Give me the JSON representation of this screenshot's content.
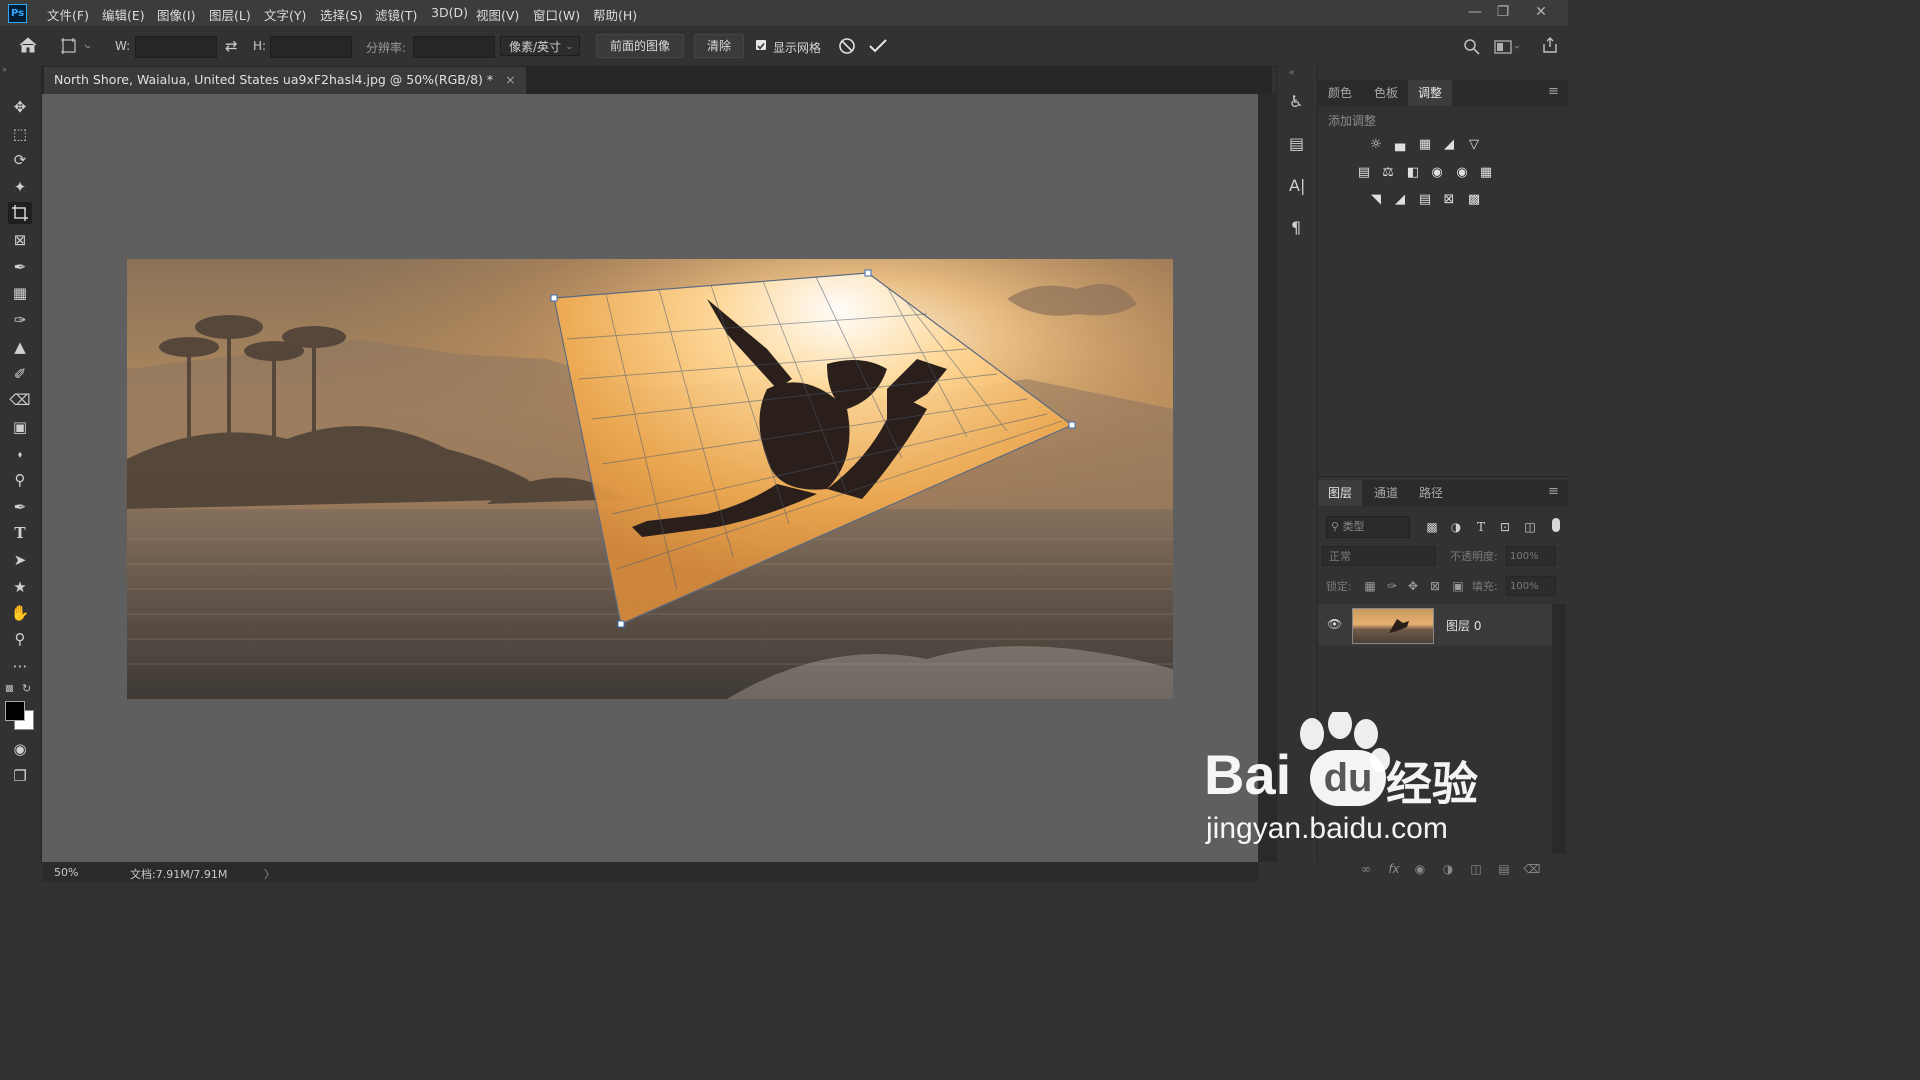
{
  "app": {
    "logo": "Ps"
  },
  "menu": [
    "文件(F)",
    "编辑(E)",
    "图像(I)",
    "图层(L)",
    "文字(Y)",
    "选择(S)",
    "滤镜(T)",
    "3D(D)",
    "视图(V)",
    "窗口(W)",
    "帮助(H)"
  ],
  "options": {
    "w_label": "W:",
    "h_label": "H:",
    "resolution_label": "分辨率:",
    "unit": "像素/英寸",
    "front_image": "前面的图像",
    "clear": "清除",
    "show_grid": "显示网格"
  },
  "document": {
    "tab_title": "North Shore, Waialua, United States ua9xF2hasl4.jpg @ 50%(RGB/8) *",
    "close": "×"
  },
  "panels": {
    "top_tabs": [
      "颜色",
      "色板",
      "调整"
    ],
    "active_top_tab": "调整",
    "add_adjustment": "添加调整",
    "layer_tabs": [
      "图层",
      "通道",
      "路径"
    ],
    "filter_kind": "类型",
    "blend_mode": "正常",
    "opacity_label": "不透明度:",
    "opacity_value": "100%",
    "lock_label": "锁定:",
    "fill_label": "填充:",
    "fill_value": "100%",
    "layer_name": "图层 0"
  },
  "status": {
    "zoom": "50%",
    "doc_info": "文档:7.91M/7.91M",
    "arrow": "〉"
  },
  "watermark": {
    "brand": "Bai",
    "brand2": "du",
    "cn": "经验",
    "url": "jingyan.baidu.com"
  },
  "colors": {
    "accent": "#31a8ff",
    "chrome": "#323232",
    "canvas": "#5f5f5f"
  }
}
